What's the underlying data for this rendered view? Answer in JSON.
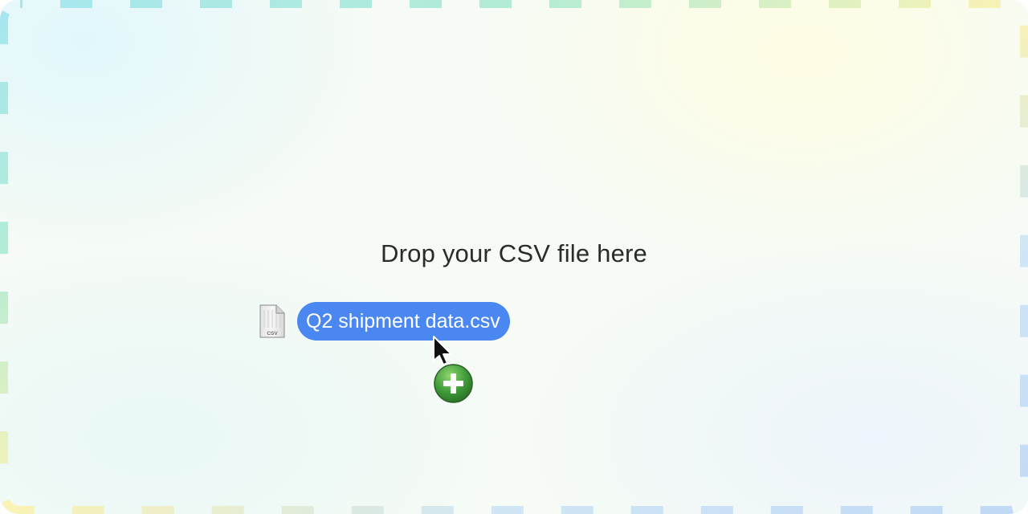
{
  "dropzone": {
    "label": "Drop your CSV file here"
  },
  "drag": {
    "file_name": "Q2 shipment data.csv",
    "file_type_badge": "CSV",
    "file_icon": "csv-file-icon",
    "cursor_icon": "arrow-cursor-icon",
    "badge_icon": "add-copy-plus-icon"
  },
  "colors": {
    "pill": "#4b87f0",
    "badge_green": "#3f9a3a",
    "label_text": "#2b2b2b"
  }
}
